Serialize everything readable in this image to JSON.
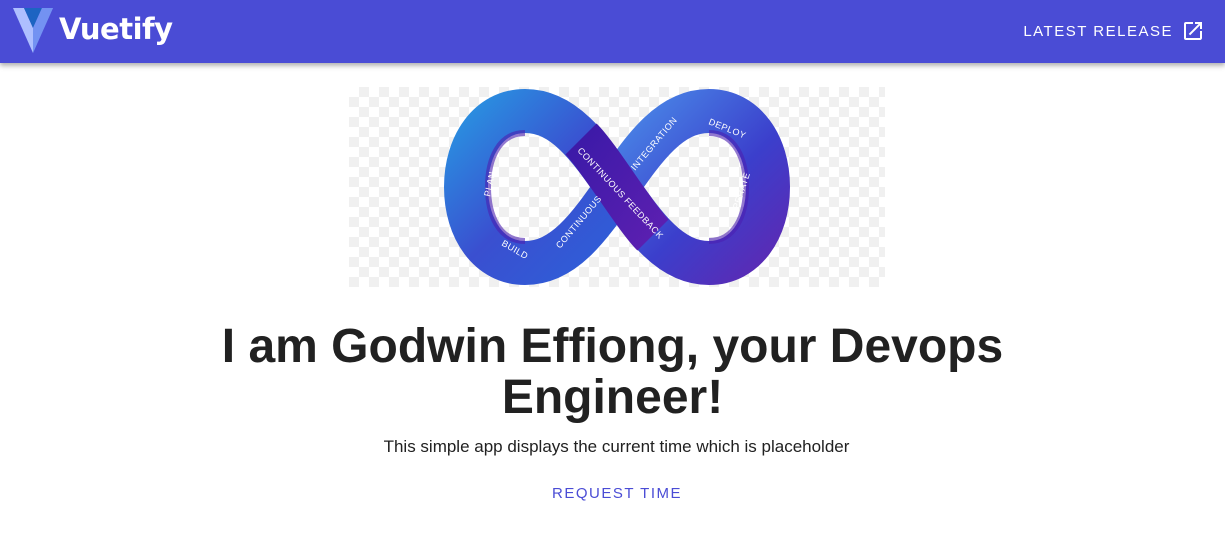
{
  "app_bar": {
    "brand_name": "Vuetify",
    "brand_logo_icon": "vuetify-logo",
    "release_link_label": "LATEST RELEASE",
    "release_link_icon": "open-in-new-icon",
    "background_color": "#4a4cd5"
  },
  "hero": {
    "image_icon": "devops-infinity-loop",
    "loop_labels": [
      "PLAN",
      "BUILD",
      "CONTINUOUS",
      "CONTINUOUS FEEDBACK",
      "INTEGRATION",
      "DEPLOY",
      "OPERATE"
    ]
  },
  "main": {
    "headline": "I am Godwin Effiong, your Devops Engineer!",
    "subtitle": "This simple app displays the current time which is placeholder",
    "request_button_label": "REQUEST TIME",
    "accent_color": "#4a4cd5"
  }
}
